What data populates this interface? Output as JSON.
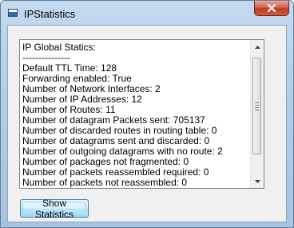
{
  "window": {
    "title": "IPStatistics"
  },
  "stats_text": {
    "lines": [
      "IP Global Statics:",
      "---------------",
      "Default TTL Time: 128",
      "Forwarding enabled: True",
      "Number of Network Interfaces: 2",
      "Number of IP Addresses: 12",
      "Number of Routes: 11",
      "Number of datagram Packets sent: 705137",
      "Number of discarded routes in routing table: 0",
      "Number of datagrams sent and discarded: 0",
      "Number of outgoing datagrams with no route: 2",
      "Number of packages not fragmented: 0",
      "Number of packets reassembled required: 0",
      "Number of packets not reassembled: 0"
    ]
  },
  "buttons": {
    "show_statistics": "Show Statistics"
  }
}
